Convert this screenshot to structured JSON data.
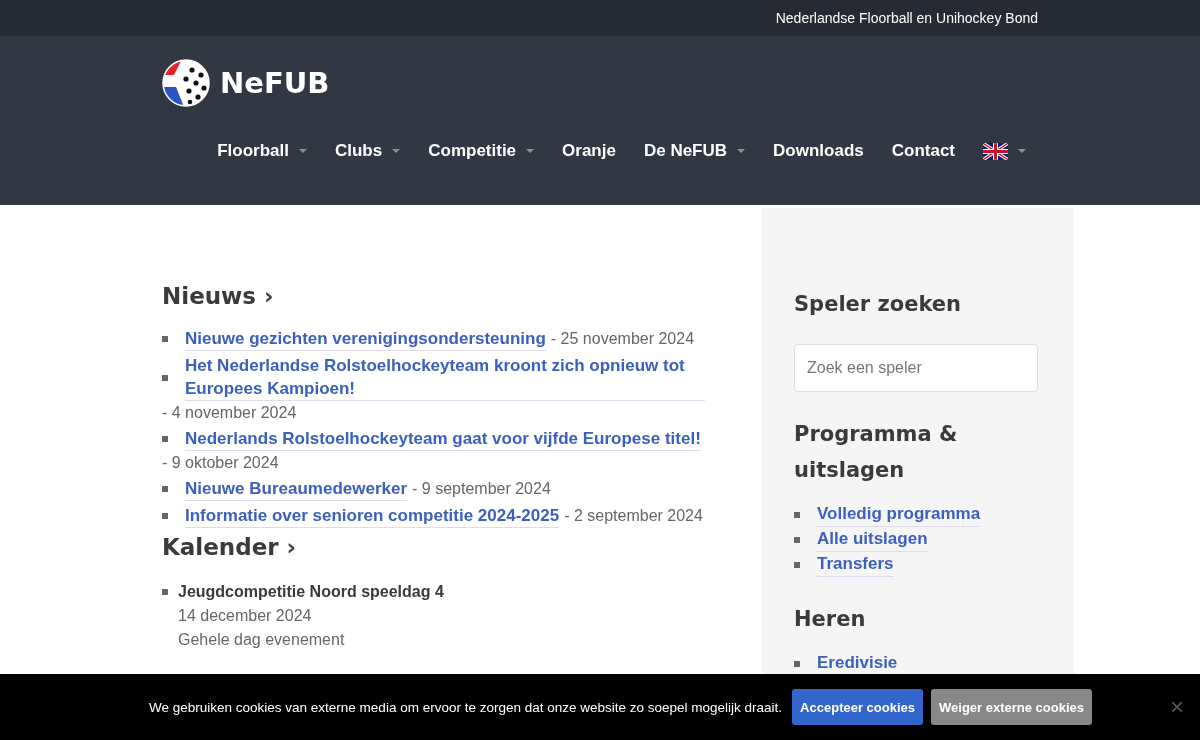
{
  "top_bar": {
    "text": "Nederlandse Floorball en Unihockey Bond"
  },
  "logo": {
    "text": "NeFUB"
  },
  "nav": [
    {
      "kind": "link",
      "label": "Floorball",
      "has_dropdown": true
    },
    {
      "kind": "link",
      "label": "Clubs",
      "has_dropdown": true
    },
    {
      "kind": "link",
      "label": "Competitie",
      "has_dropdown": true
    },
    {
      "kind": "link",
      "label": "Oranje",
      "has_dropdown": false
    },
    {
      "kind": "link",
      "label": "De NeFUB",
      "has_dropdown": true
    },
    {
      "kind": "link",
      "label": "Downloads",
      "has_dropdown": false
    },
    {
      "kind": "link",
      "label": "Contact",
      "has_dropdown": false
    },
    {
      "kind": "language",
      "has_dropdown": true
    }
  ],
  "news": {
    "heading": "Nieuws ›",
    "items": [
      {
        "title": "Nieuwe gezichten verenigingsondersteuning",
        "date": "- 25 november 2024"
      },
      {
        "title": "Het Nederlandse Rolstoelhockeyteam kroont zich opnieuw tot Europees Kampioen!",
        "date": "- 4 november 2024"
      },
      {
        "title": "Nederlands Rolstoelhockeyteam gaat voor vijfde Europese titel!",
        "date": "- 9 oktober 2024"
      },
      {
        "title": "Nieuwe Bureaumedewerker",
        "date": "- 9 september 2024"
      },
      {
        "title": "Informatie over senioren competitie 2024-2025",
        "date": "- 2 september 2024"
      }
    ]
  },
  "calendar": {
    "heading": "Kalender ›",
    "items": [
      {
        "title": "Jeugdcompetitie Noord speeldag 4",
        "date": "14 december 2024",
        "note": "Gehele dag evenement"
      }
    ]
  },
  "sidebar": {
    "search": {
      "heading": "Speler zoeken",
      "placeholder": "Zoek een speler"
    },
    "sections": [
      {
        "heading": "Programma & uitslagen",
        "links": [
          "Volledig programma",
          "Alle uitslagen",
          "Transfers"
        ]
      },
      {
        "heading": "Heren",
        "links": [
          "Eredivisie"
        ]
      }
    ]
  },
  "cookie_bar": {
    "message": "We gebruiken cookies van externe media om ervoor te zorgen dat onze website zo soepel mogelijk draait.",
    "accept": "Accepteer cookies",
    "reject": "Weiger externe cookies",
    "close": "×"
  }
}
